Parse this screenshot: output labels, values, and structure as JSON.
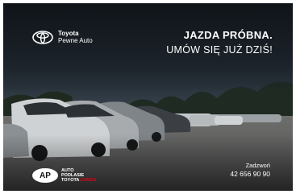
{
  "brand": {
    "name": "Toyota",
    "tagline": "Pewne Auto",
    "icon": "toyota-logo-icon"
  },
  "headline": {
    "line1": "JAZDA PRÓBNA.",
    "line2": "UMÓW SIĘ JUŻ DZIŚ!"
  },
  "dealer": {
    "badge": "AP",
    "line1": "AUTO",
    "line2": "PODLASIE",
    "line3_brand": "TOYOTA",
    "line3_city": "ŁOMŻA"
  },
  "contact": {
    "label": "Zadzwoń",
    "phone": "42 656 90 90"
  },
  "colors": {
    "background": "#1b2128",
    "text": "#ffffff",
    "dealer_accent": "#e60012"
  }
}
